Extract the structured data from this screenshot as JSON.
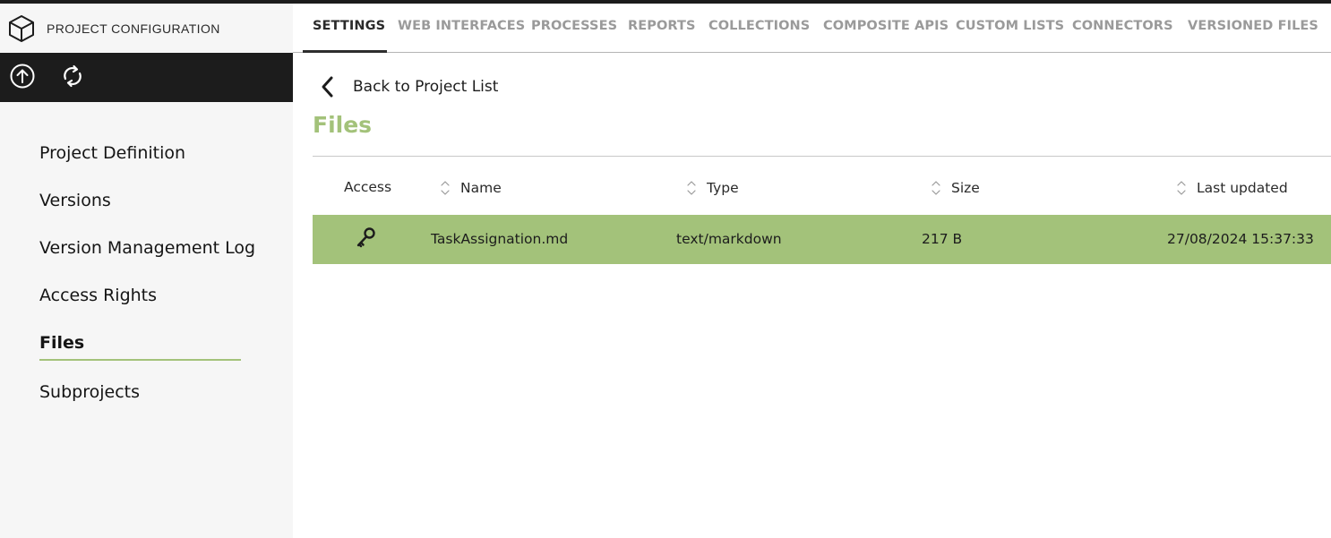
{
  "sidebar": {
    "header": {
      "icon": "cube-icon",
      "title": "PROJECT CONFIGURATION"
    },
    "toolbar": [
      {
        "icon": "upload-circle-icon",
        "label": "Upload"
      },
      {
        "icon": "sync-icon",
        "label": "Refresh"
      }
    ],
    "nav": [
      {
        "label": "Project Definition",
        "active": false
      },
      {
        "label": "Versions",
        "active": false
      },
      {
        "label": "Version Management Log",
        "active": false
      },
      {
        "label": "Access Rights",
        "active": false
      },
      {
        "label": "Files",
        "active": true
      },
      {
        "label": "Subprojects",
        "active": false
      }
    ]
  },
  "tabs": [
    {
      "label": "SETTINGS",
      "active": true
    },
    {
      "label": "WEB INTERFACES",
      "active": false
    },
    {
      "label": "PROCESSES",
      "active": false
    },
    {
      "label": "REPORTS",
      "active": false
    },
    {
      "label": "COLLECTIONS",
      "active": false
    },
    {
      "label": "COMPOSITE APIS",
      "active": false
    },
    {
      "label": "CUSTOM LISTS",
      "active": false
    },
    {
      "label": "CONNECTORS",
      "active": false
    },
    {
      "label": "VERSIONED FILES",
      "active": false
    }
  ],
  "back_link": {
    "icon": "chevron-left-icon",
    "label": "Back to Project List"
  },
  "page_title": "Files",
  "table": {
    "columns": [
      {
        "label": "Access",
        "sortable": false
      },
      {
        "label": "Name",
        "sortable": true
      },
      {
        "label": "Type",
        "sortable": true
      },
      {
        "label": "Size",
        "sortable": true
      },
      {
        "label": "Last updated",
        "sortable": true
      }
    ],
    "rows": [
      {
        "access_icon": "key-icon",
        "name": "TaskAssignation.md",
        "type": "text/markdown",
        "size": "217 B",
        "last_updated": "27/08/2024 15:37:33",
        "selected": true
      }
    ]
  },
  "colors": {
    "accent": "#a3c27a",
    "dark": "#1c1c1c",
    "sidebar_bg": "#f6f6f6",
    "tab_inactive": "#9a9a9a"
  }
}
